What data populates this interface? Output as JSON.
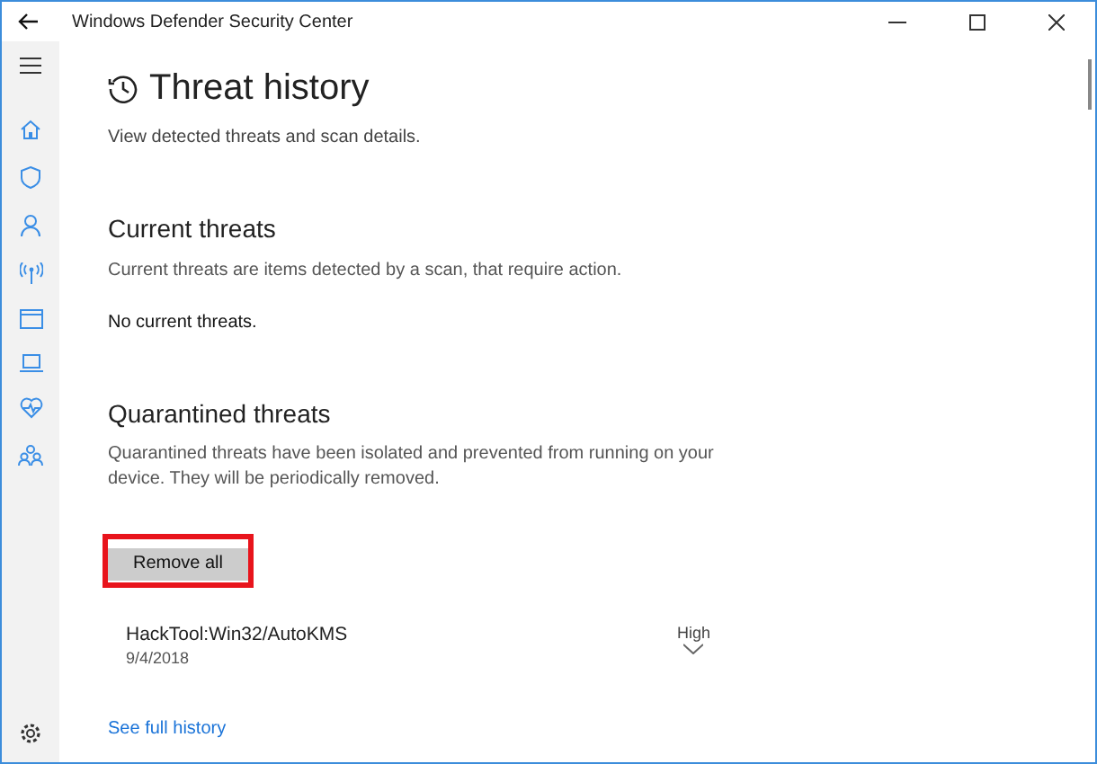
{
  "window": {
    "title": "Windows Defender Security Center"
  },
  "page": {
    "title": "Threat history",
    "subtitle": "View detected threats and scan details."
  },
  "current_threats": {
    "heading": "Current threats",
    "description": "Current threats are items detected by a scan, that require action.",
    "status": "No current threats."
  },
  "quarantined_threats": {
    "heading": "Quarantined threats",
    "description": "Quarantined threats have been isolated and prevented from running on your device.  They will be periodically removed.",
    "button": {
      "label": "Remove all",
      "highlighted": true
    },
    "items": [
      {
        "name": "HackTool:Win32/AutoKMS",
        "date": "9/4/2018",
        "severity": "High",
        "expanded": false
      }
    ]
  },
  "link": "See full history"
}
